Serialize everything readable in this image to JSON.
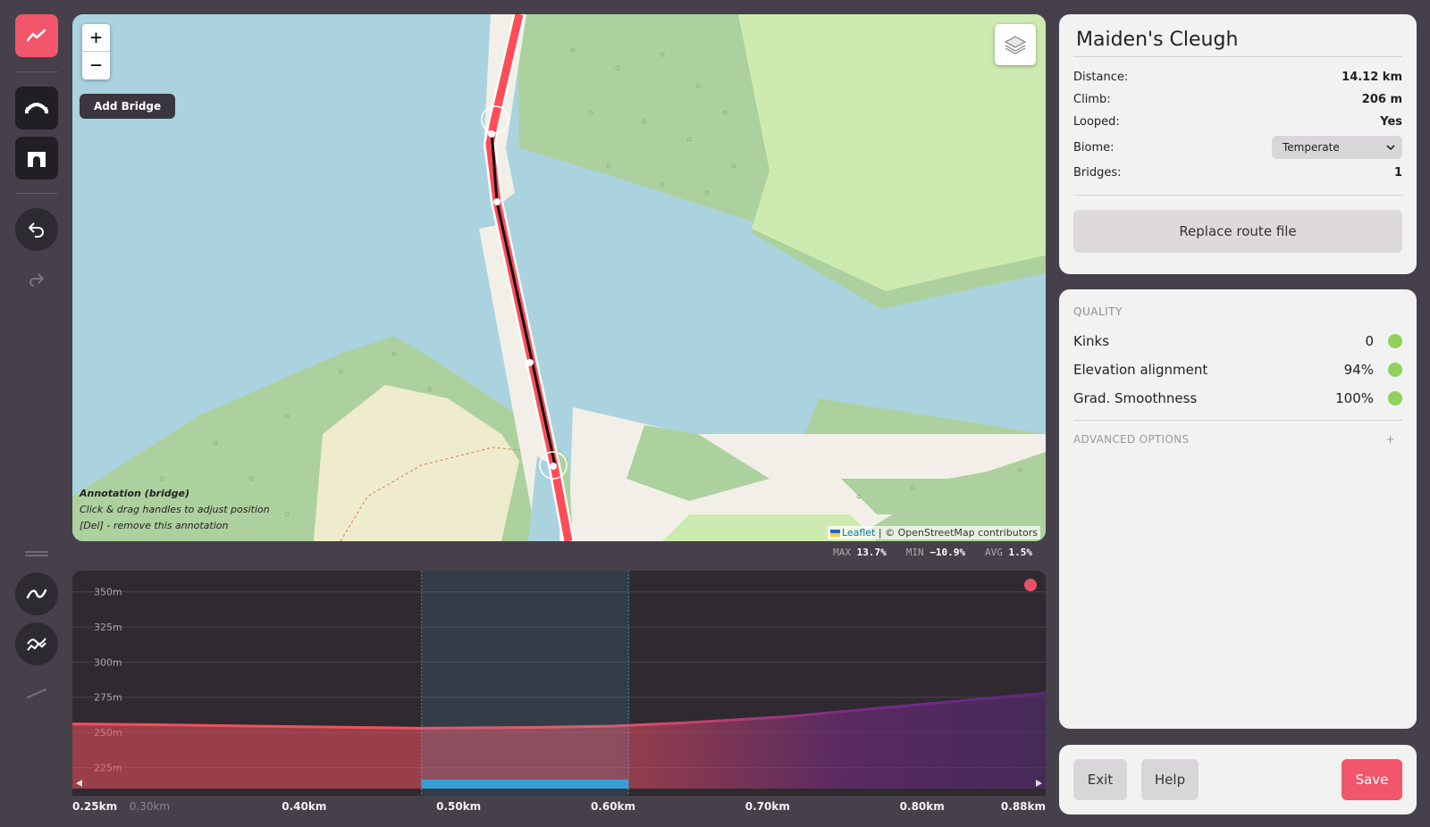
{
  "toolbar": {
    "buttons": [
      "elevation-mode",
      "add-bridge",
      "add-tunnel",
      "undo",
      "redo",
      "smooth",
      "smooth-advanced",
      "straighten"
    ]
  },
  "map": {
    "zoom_in": "+",
    "zoom_out": "−",
    "tooltip": "Add Bridge",
    "annotation": {
      "title": "Annotation (bridge)",
      "line1": "Click & drag handles to adjust position",
      "line2": "[Del] - remove this annotation"
    },
    "attribution": {
      "leaflet": "Leaflet",
      "rest": " | © OpenStreetMap contributors"
    }
  },
  "grade_stats": {
    "max_label": "MAX",
    "max_value": "13.7%",
    "min_label": "MIN",
    "min_value": "−10.9%",
    "avg_label": "AVG",
    "avg_value": "1.5%"
  },
  "chart_data": {
    "type": "area",
    "title": "",
    "xlabel": "",
    "ylabel": "",
    "y_ticks": [
      "350m",
      "325m",
      "300m",
      "275m",
      "250m",
      "225m"
    ],
    "x_ticks": [
      "0.25km",
      "0.30km",
      "0.40km",
      "0.50km",
      "0.60km",
      "0.70km",
      "0.80km",
      "0.88km"
    ],
    "ylim": [
      210,
      360
    ],
    "xlim": [
      0.25,
      0.88
    ],
    "x": [
      0.25,
      0.3,
      0.4,
      0.476,
      0.55,
      0.6,
      0.65,
      0.71,
      0.75,
      0.8,
      0.88
    ],
    "y": [
      256,
      255.5,
      254,
      253,
      253.5,
      254.5,
      257,
      261,
      265,
      270,
      278
    ],
    "selection_km": [
      0.476,
      0.61
    ],
    "colors": {
      "low": "#f0505f",
      "high": "#7a2a8a",
      "selection": "#3a9fd6"
    }
  },
  "route": {
    "name": "Maiden's Cleugh",
    "distance_label": "Distance:",
    "distance": "14.12 km",
    "climb_label": "Climb:",
    "climb": "206 m",
    "looped_label": "Looped:",
    "looped": "Yes",
    "biome_label": "Biome:",
    "biome": "Temperate",
    "bridges_label": "Bridges:",
    "bridges": "1",
    "replace_button": "Replace route file"
  },
  "quality": {
    "heading": "QUALITY",
    "rows": [
      {
        "label": "Kinks",
        "value": "0",
        "status_color": "#8fd15a"
      },
      {
        "label": "Elevation alignment",
        "value": "94%",
        "status_color": "#8fd15a"
      },
      {
        "label": "Grad. Smoothness",
        "value": "100%",
        "status_color": "#8fd15a"
      }
    ],
    "advanced": "ADVANCED OPTIONS",
    "advanced_toggle": "+"
  },
  "footer": {
    "exit": "Exit",
    "help": "Help",
    "save": "Save"
  }
}
